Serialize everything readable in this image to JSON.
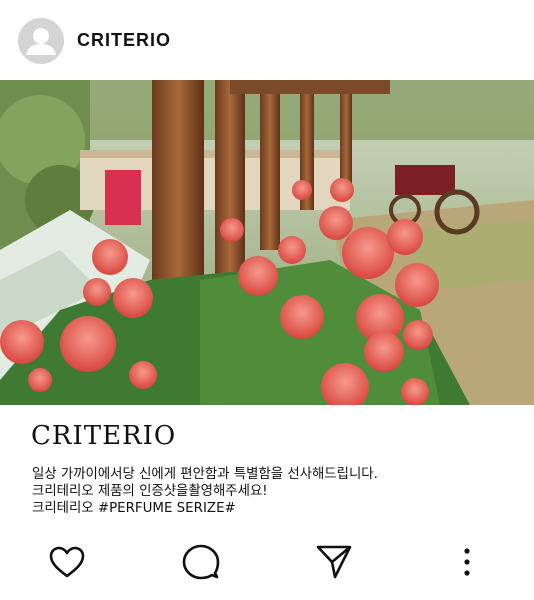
{
  "post": {
    "username": "CRITERIO",
    "brand": "CRITERIO",
    "caption": [
      "일상 가까이에서당 신에게 편안함과 특별함을 선사해드립니다.",
      "크리테리오 제품의 인증샷을촬영해주세요!",
      "크리테리오 #PERFUME SERIZE#"
    ]
  },
  "icons": {
    "avatar": "user-avatar-icon",
    "like": "heart-icon",
    "comment": "comment-bubble-icon",
    "share": "send-paper-plane-icon",
    "more": "more-vertical-icon"
  },
  "colors": {
    "avatar_bg": "#d4d4d4",
    "icon_stroke": "#111111",
    "flower": "#e8605a"
  }
}
